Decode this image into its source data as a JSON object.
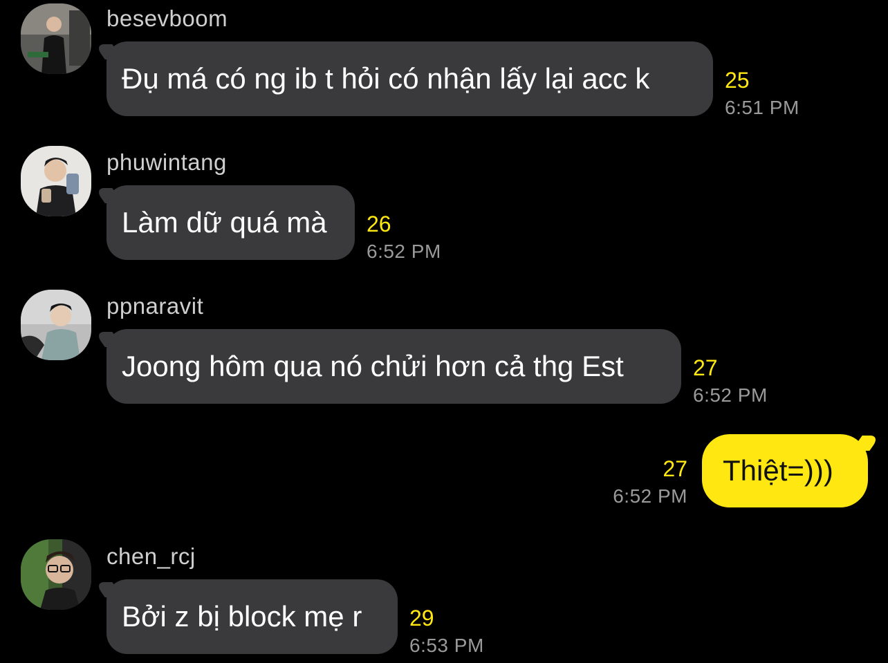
{
  "messages": [
    {
      "sender": "besevboom",
      "text": "Đụ má có ng ib t hỏi có nhận lấy lại acc k",
      "unread_count": "25",
      "time": "6:51 PM",
      "direction": "incoming"
    },
    {
      "sender": "phuwintang",
      "text": "Làm dữ quá mà",
      "unread_count": "26",
      "time": "6:52 PM",
      "direction": "incoming"
    },
    {
      "sender": "ppnaravit",
      "text": "Joong hôm qua nó chửi hơn cả thg Est",
      "unread_count": "27",
      "time": "6:52 PM",
      "direction": "incoming"
    },
    {
      "sender": "",
      "text": "Thiệt=)))",
      "unread_count": "27",
      "time": "6:52 PM",
      "direction": "outgoing"
    },
    {
      "sender": "chen_rcj",
      "text": "Bởi z bị block mẹ r",
      "unread_count": "29",
      "time": "6:53 PM",
      "direction": "incoming"
    }
  ],
  "colors": {
    "background": "#000000",
    "incoming_bubble": "#3a3a3c",
    "outgoing_bubble": "#ffe812",
    "unread_count": "#ffe812",
    "timestamp": "#9a9a9a"
  }
}
